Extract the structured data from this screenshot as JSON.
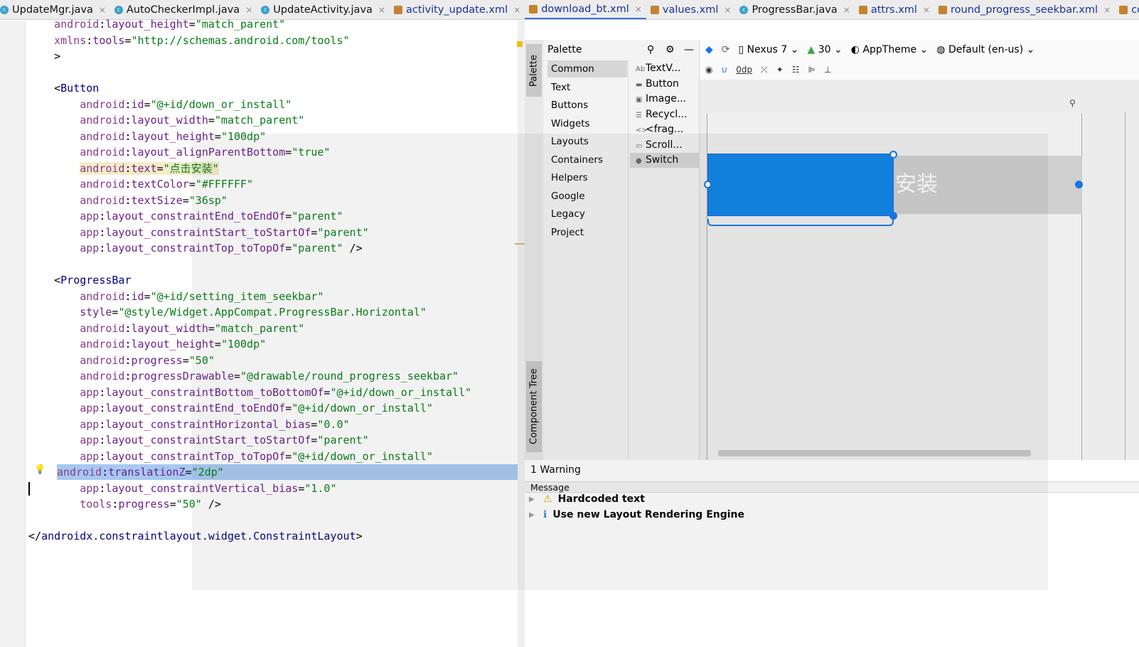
{
  "tabs": [
    {
      "label": "UpdateMgr.java",
      "icon": "class"
    },
    {
      "label": "AutoCheckerImpl.java",
      "icon": "class"
    },
    {
      "label": "UpdateActivity.java",
      "icon": "class"
    },
    {
      "label": "activity_update.xml",
      "icon": "xml"
    },
    {
      "label": "download_bt.xml",
      "icon": "xml",
      "active": true
    },
    {
      "label": "values.xml",
      "icon": "xml"
    },
    {
      "label": "ProgressBar.java",
      "icon": "class"
    },
    {
      "label": "attrs.xml",
      "icon": "xml"
    },
    {
      "label": "round_progress_seekbar.xml",
      "icon": "xml"
    },
    {
      "label": "colors.x",
      "icon": "xml"
    }
  ],
  "editor": {
    "lines": [
      "    android:layout_height=\"match_parent\"",
      "    xmlns:tools=\"http://schemas.android.com/tools\"",
      "    >",
      "",
      "    <Button",
      "        android:id=\"@+id/down_or_install\"",
      "        android:layout_width=\"match_parent\"",
      "        android:layout_height=\"100dp\"",
      "        android:layout_alignParentBottom=\"true\"",
      "        android:text=\"点击安装\"",
      "        android:textColor=\"#FFFFFF\"",
      "        android:textSize=\"36sp\"",
      "        app:layout_constraintEnd_toEndOf=\"parent\"",
      "        app:layout_constraintStart_toStartOf=\"parent\"",
      "        app:layout_constraintTop_toTopOf=\"parent\" />",
      "",
      "    <ProgressBar",
      "        android:id=\"@+id/setting_item_seekbar\"",
      "        style=\"@style/Widget.AppCompat.ProgressBar.Horizontal\"",
      "        android:layout_width=\"match_parent\"",
      "        android:layout_height=\"100dp\"",
      "        android:progress=\"50\"",
      "        android:progressDrawable=\"@drawable/round_progress_seekbar\"",
      "        app:layout_constraintBottom_toBottomOf=\"@+id/down_or_install\"",
      "        app:layout_constraintEnd_toEndOf=\"@+id/down_or_install\"",
      "        app:layout_constraintHorizontal_bias=\"0.0\"",
      "        app:layout_constraintStart_toStartOf=\"parent\"",
      "        app:layout_constraintTop_toTopOf=\"@+id/down_or_install\"",
      "        android:translationZ=\"2dp\"",
      "        app:layout_constraintVertical_bias=\"1.0\"",
      "        tools:progress=\"50\" />",
      "",
      "</androidx.constraintlayout.widget.ConstraintLayout>"
    ],
    "highlighted_line": 28,
    "warning_line": 9
  },
  "side_tabs": {
    "palette": "Palette",
    "component_tree": "Component Tree"
  },
  "palette": {
    "title": "Palette",
    "categories": [
      "Common",
      "Text",
      "Buttons",
      "Widgets",
      "Layouts",
      "Containers",
      "Helpers",
      "Google",
      "Legacy",
      "Project"
    ],
    "selected_category": "Common",
    "items": [
      {
        "label": "TextV...",
        "icon": "Ab"
      },
      {
        "label": "Button",
        "icon": "▬"
      },
      {
        "label": "Image...",
        "icon": "▣"
      },
      {
        "label": "Recycl...",
        "icon": "☰"
      },
      {
        "label": "<frag...",
        "icon": "<>"
      },
      {
        "label": "Scroll...",
        "icon": "▭"
      },
      {
        "label": "Switch",
        "icon": "●"
      }
    ],
    "selected_item": "Switch"
  },
  "design_toolbar": {
    "device": "Nexus 7",
    "api": "30",
    "theme": "AppTheme",
    "locale": "Default (en-us)",
    "margin": "0dp"
  },
  "canvas": {
    "button_text_visible": "安装",
    "button_color": "#0a84e8",
    "progress": 50
  },
  "warnings": {
    "header": "1 Warning",
    "column": "Message",
    "items": [
      {
        "type": "warning",
        "text": "Hardcoded text"
      },
      {
        "type": "info",
        "text": "Use new Layout Rendering Engine"
      }
    ]
  }
}
